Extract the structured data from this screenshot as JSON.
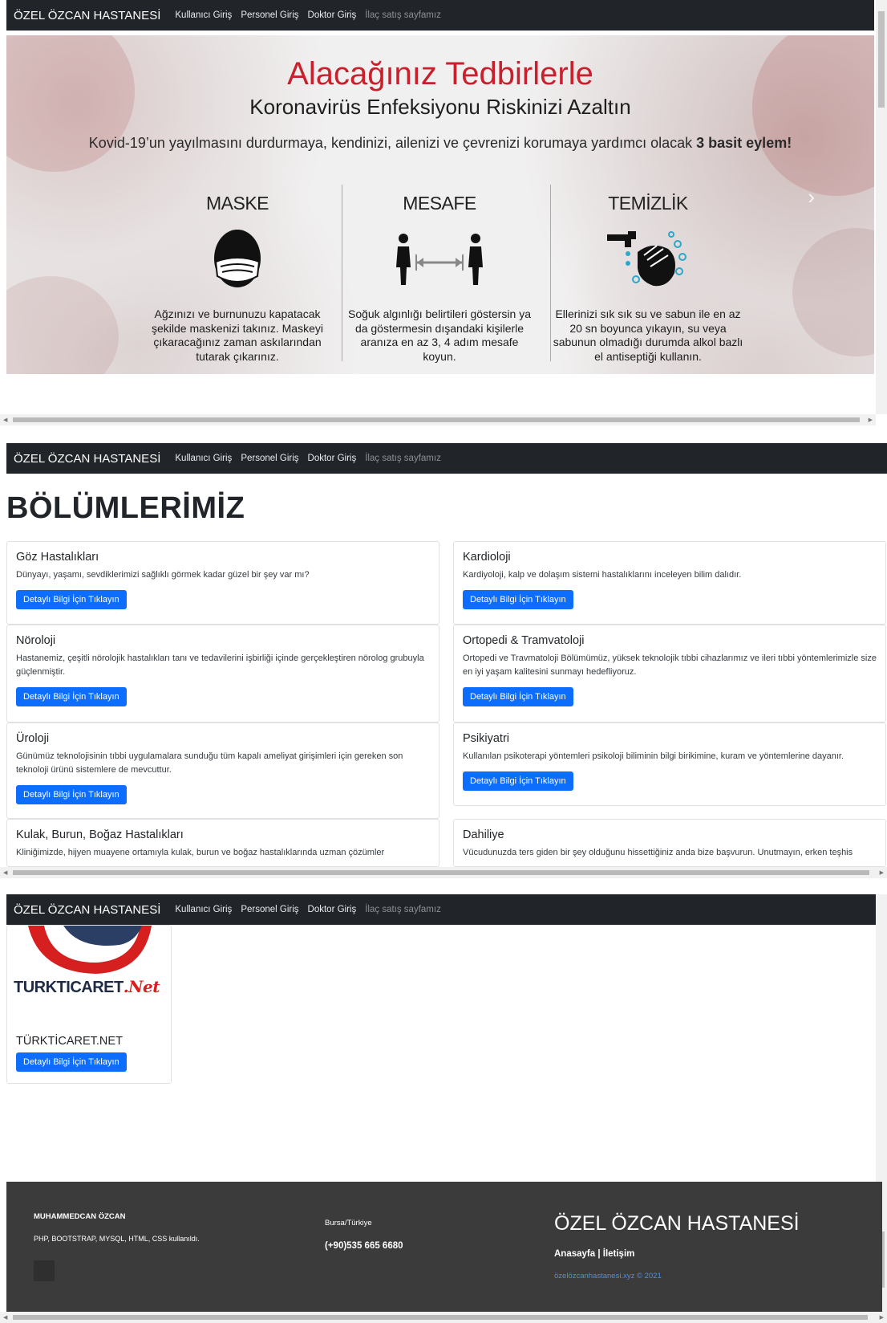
{
  "nav": {
    "brand": "ÖZEL ÖZCAN HASTANESİ",
    "links": [
      "Kullanıcı Giriş",
      "Personel Giriş",
      "Doktor Giriş",
      "İlaç satış sayfamız"
    ]
  },
  "hero": {
    "title": "Alacağınız Tedbirlerle",
    "subtitle": "Koronavirüs Enfeksiyonu Riskinizi Azaltın",
    "lead_prefix": "Kovid-19’un yayılmasını durdurmaya, kendinizi, ailenizi ve çevrenizi korumaya yardımcı olacak",
    "lead_bold": "3 basit eylem!",
    "columns": [
      {
        "title": "MASKE",
        "icon": "face-mask-icon",
        "text": "Ağzınızı ve burnunuzu kapatacak şekilde maskenizi takınız. Maskeyi çıkaracağınız zaman askılarından tutarak çıkarınız."
      },
      {
        "title": "MESAFE",
        "icon": "distance-icon",
        "text": "Soğuk algınlığı belirtileri göstersin ya da göstermesin dışandaki kişilerle aranıza en az 3, 4 adım mesafe koyun."
      },
      {
        "title": "TEMİZLİK",
        "icon": "hand-washing-icon",
        "text": "Ellerinizi sık sık su ve sabun ile en az 20 sn boyunca yıkayın, su veya sabunun olmadığı durumda alkol bazlı el antiseptiği kullanın."
      }
    ],
    "next_icon": "›"
  },
  "departments": {
    "heading": "BÖLÜMLERİMİZ",
    "button_label": "Detaylı Bilgi İçin Tıklayın",
    "items": [
      {
        "title": "Göz Hastalıkları",
        "text": "Dünyayı, yaşamı, sevdiklerimizi sağlıklı görmek kadar güzel bir şey var mı?"
      },
      {
        "title": "Kardioloji",
        "text": "Kardiyoloji, kalp ve dolaşım sistemi hastalıklarını inceleyen bilim dalıdır."
      },
      {
        "title": "Nöroloji",
        "text": "Hastanemiz, çeşitli nörolojik hastalıkları tanı ve tedavilerini işbirliği içinde gerçekleştiren nörolog grubuyla güçlenmiştir."
      },
      {
        "title": "Ortopedi & Tramvatoloji",
        "text": "Ortopedi ve Travmatoloji Bölümümüz, yüksek teknolojik tıbbi cihazlarımız ve ileri tıbbi yöntemlerimizle size en iyi yaşam kalitesini sunmayı hedefliyoruz."
      },
      {
        "title": "Üroloji",
        "text": "Günümüz teknolojisinin tıbbi uygulamalara sunduğu tüm kapalı ameliyat girişimleri için gereken son teknoloji ürünü sistemlere de mevcuttur."
      },
      {
        "title": "Psikiyatri",
        "text": "Kullanılan psikoterapi yöntemleri psikoloji biliminin bilgi birikimine, kuram ve yöntemlerine dayanır."
      },
      {
        "title": "Kulak, Burun, Boğaz Hastalıkları",
        "text": "Kliniğimizde, hijyen muayene ortamıyla kulak, burun ve boğaz hastalıklarında uzman çözümler"
      },
      {
        "title": "Dahiliye",
        "text": "Vücudunuzda ters giden bir şey olduğunu hissettiğiniz anda bize başvurun. Unutmayın, erken teşhis"
      }
    ]
  },
  "partner": {
    "logo_text": "TURKTICARET",
    "logo_suffix": ".Net",
    "name": "TÜRKTİCARET.NET",
    "button_label": "Detaylı Bilgi İçin Tıklayın"
  },
  "footer": {
    "author": "MUHAMMEDCAN ÖZCAN",
    "tech": "PHP, BOOTSTRAP, MYSQL, HTML, CSS kullanıldı.",
    "city": "Bursa/Türkiye",
    "phone": "(+90)535 665 6680",
    "brand": "ÖZEL ÖZCAN HASTANESİ",
    "links": "Anasayfa | İletişim",
    "copyright": "özelözcanhastanesi.xyz © 2021"
  },
  "colors": {
    "navbar": "#212529",
    "primary": "#0d6efd",
    "hero_title": "#c8202c",
    "footer": "#3b3b3b",
    "footer_link": "#4a90e2"
  }
}
